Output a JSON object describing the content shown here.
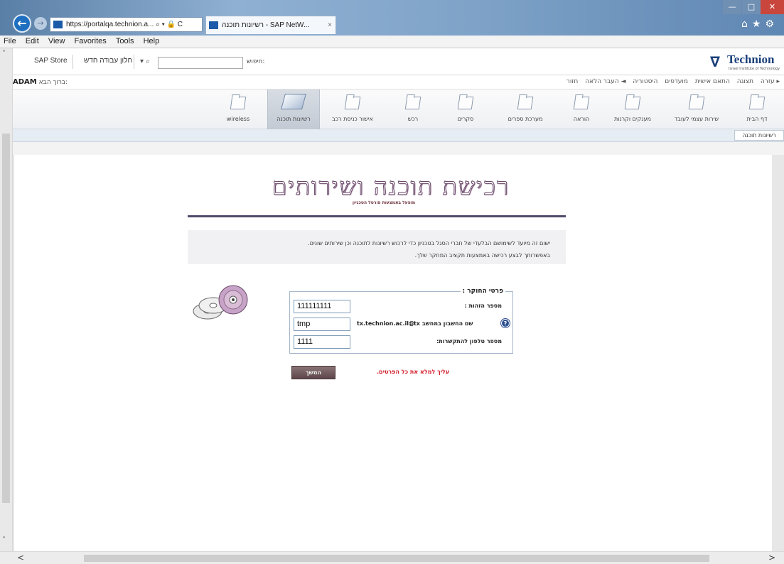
{
  "browser": {
    "address_url": "https://portalqa.technion.a...",
    "address_suffix": "⌕ ▾ 🔒 C",
    "tab_title": "רשיונות תוכנה - SAP NetW...",
    "tab_close": "×",
    "back": "←",
    "forward": "→",
    "min": "—",
    "max": "□",
    "close": "✕",
    "tb_icons": "⌂★⚙",
    "menu": [
      {
        "label": "File"
      },
      {
        "label": "Edit"
      },
      {
        "label": "View"
      },
      {
        "label": "Favorites"
      },
      {
        "label": "Tools"
      },
      {
        "label": "Help"
      }
    ]
  },
  "sap": {
    "store": "SAP Store",
    "new_window": "חלון עבודה חדש",
    "search_mag": "▾ ⌕",
    "search_label": "חיפוש:",
    "logo_name": "Technion",
    "logo_sub": "Israel Institute of Technology",
    "logo_mark": "∇",
    "welcome": "ברוך הבא:",
    "welcome_user": "ADAM",
    "top_links": [
      "עזרה",
      "תצוגה",
      "התאם אישית",
      "מועדפים",
      "היסטוריה",
      "◄ העבר הלאה",
      "חזור ▸"
    ],
    "nav": [
      {
        "label": "דף הבית"
      },
      {
        "label": "שירות עצמי לעובד"
      },
      {
        "label": "מענקים וקרנות"
      },
      {
        "label": "הוראה"
      },
      {
        "label": "מערכת ספרים"
      },
      {
        "label": "סקרים"
      },
      {
        "label": "רכש"
      },
      {
        "label": "אישור כניסת רכב"
      },
      {
        "label": "רשיונות תוכנה"
      },
      {
        "label": "wireless"
      }
    ],
    "subnav_active": "רשיונות תוכנה",
    "scroll_up": "˄",
    "scroll_down": "˅",
    "scroll_left": "<",
    "scroll_right": ">"
  },
  "main": {
    "title": "רכישת תוכנה ושירותים",
    "subtitle": "מופעל באמצעות פורטל הטכניון",
    "info_line1": "ישום זה מיועד לשימושם הבלעדי של חברי הסגל בטכניון כדי לרכוש רשיונות לתוכנה וכן שירותים שונים.",
    "info_line2": "באפשרותך לבצע רכישה באמצעות תקציב המחקר שלך.",
    "form_legend": "פרטי החוקר :",
    "id_label": "מספר הזהות :",
    "id_value": "111111111",
    "account_label": "שם החשבון במחשב tx :",
    "account_domain": "@tx.technion.ac.il",
    "account_value": "tmp",
    "phone_label": "מספר טלפון להתקשרות:",
    "phone_value": "1111",
    "help_glyph": "?",
    "continue_label": "המשך",
    "error": "עליך למלא את כל הפרטים."
  }
}
